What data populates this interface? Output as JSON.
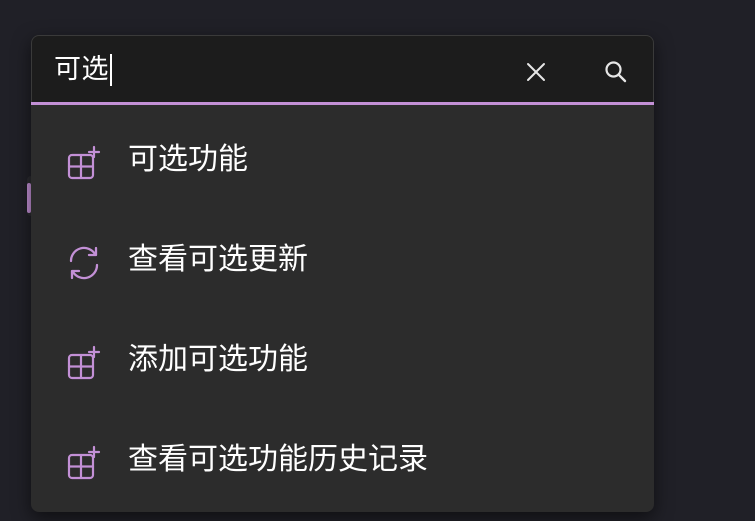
{
  "search": {
    "value": "可选",
    "clear_icon": "close-icon",
    "search_icon": "search-icon"
  },
  "suggestions": [
    {
      "label": "可选功能",
      "icon": "apps-add-icon"
    },
    {
      "label": "查看可选更新",
      "icon": "sync-icon"
    },
    {
      "label": "添加可选功能",
      "icon": "apps-add-icon"
    },
    {
      "label": "查看可选功能历史记录",
      "icon": "apps-add-icon"
    }
  ],
  "colors": {
    "accent": "#c390d6",
    "background": "#202027",
    "panel": "#2c2c2c",
    "search_box": "#1c1c1c",
    "text": "#ffffff"
  }
}
